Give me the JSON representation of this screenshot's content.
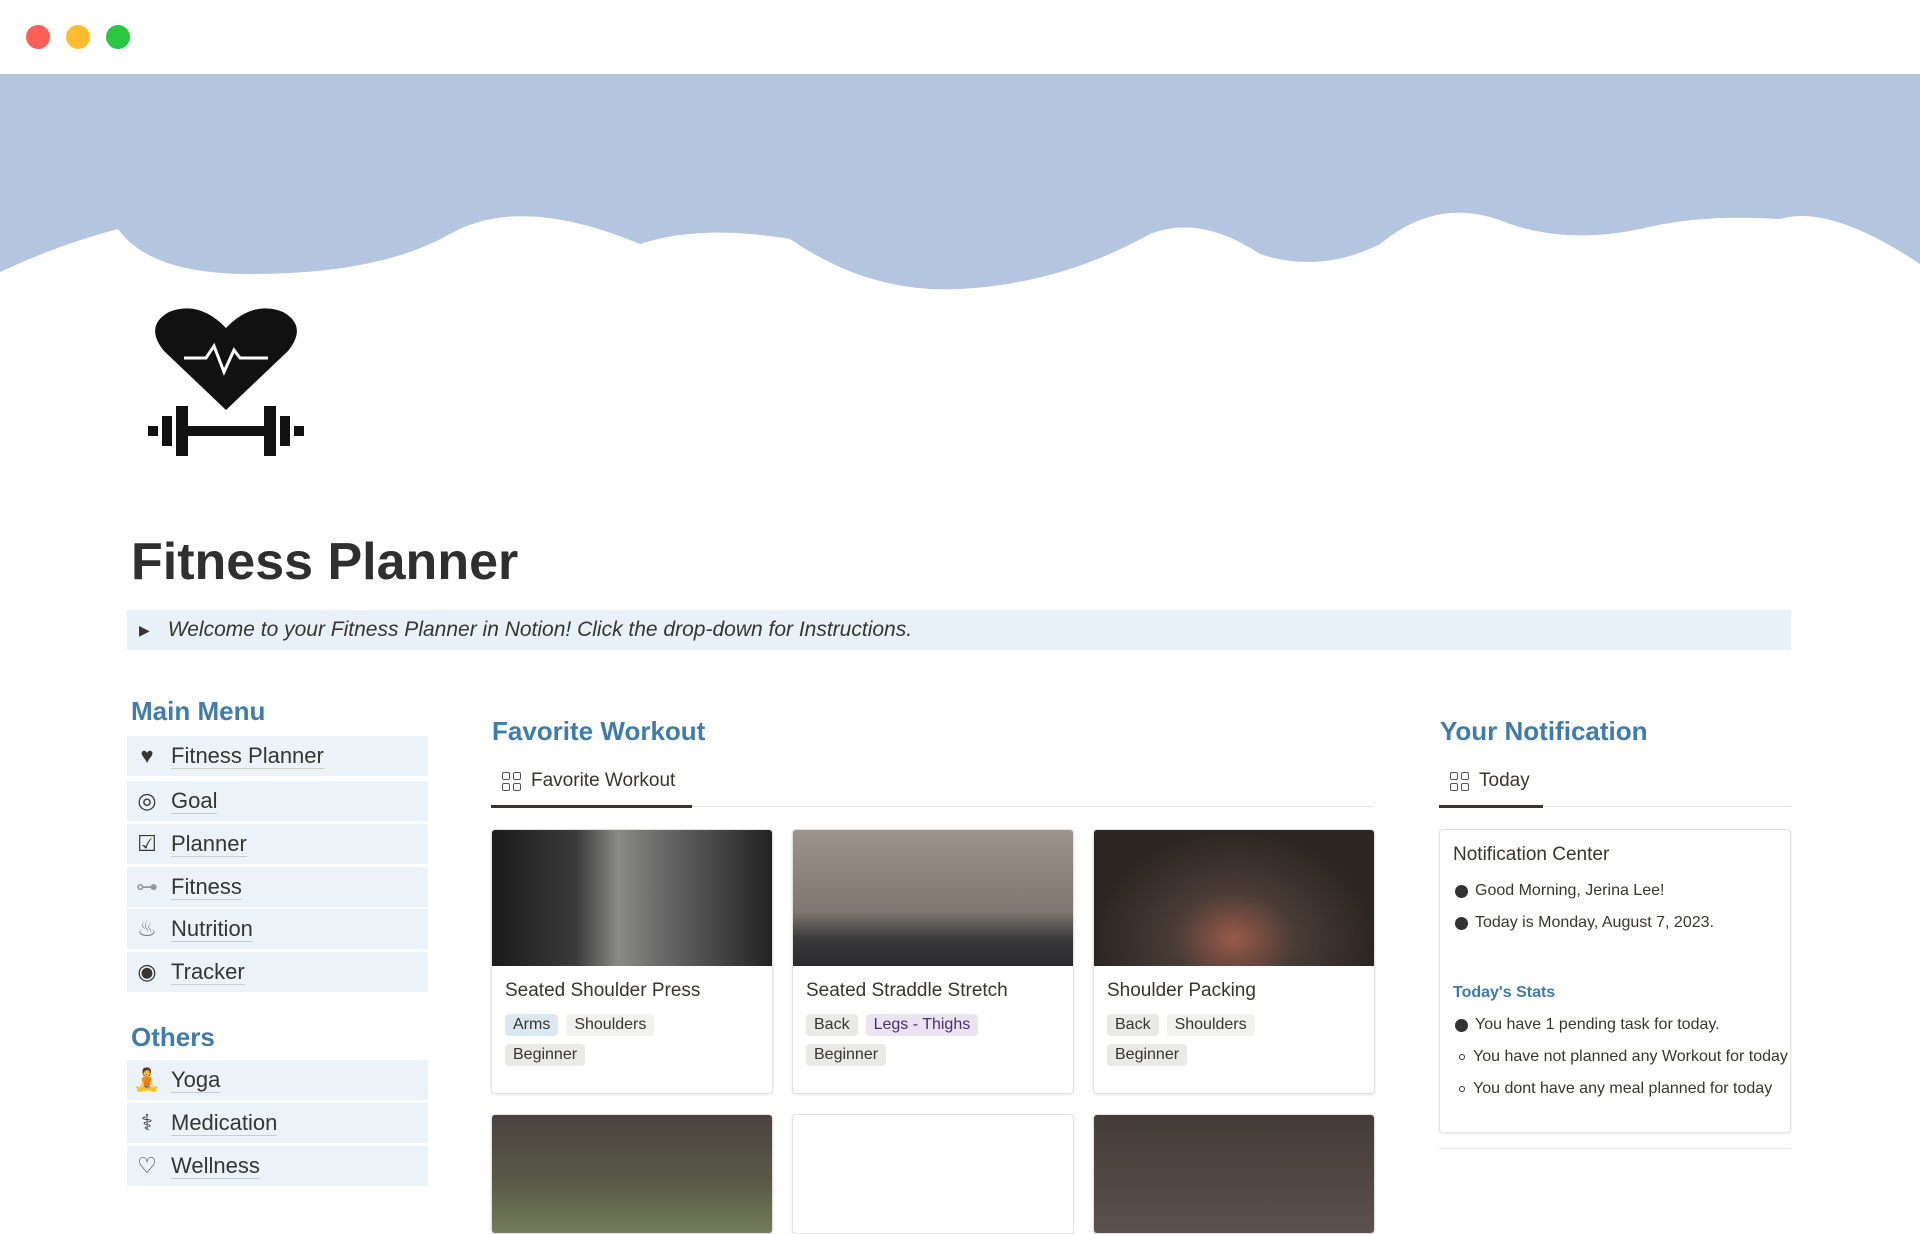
{
  "window": {
    "controls": [
      "close",
      "minimize",
      "zoom"
    ],
    "colors": {
      "close": "#fe5f57",
      "minimize": "#febc2e",
      "zoom": "#28c840"
    }
  },
  "page": {
    "title": "Fitness Planner",
    "icon": "heart-dumbbell-icon",
    "cover_color": "#b3c5df"
  },
  "callout": {
    "text": "Welcome to your Fitness Planner in Notion! Click the drop-down for Instructions."
  },
  "main_menu": {
    "heading": "Main Menu",
    "items": [
      {
        "label": "Fitness Planner",
        "icon": "heart-dumbbell-icon"
      },
      {
        "label": "Goal",
        "icon": "target-icon"
      },
      {
        "label": "Planner",
        "icon": "checklist-icon"
      },
      {
        "label": "Fitness",
        "icon": "dumbbell-icon"
      },
      {
        "label": "Nutrition",
        "icon": "food-icon"
      },
      {
        "label": "Tracker",
        "icon": "crosshair-icon"
      }
    ]
  },
  "others": {
    "heading": "Others",
    "items": [
      {
        "label": "Yoga",
        "icon": "yoga-icon"
      },
      {
        "label": "Medication",
        "icon": "stethoscope-icon"
      },
      {
        "label": "Wellness",
        "icon": "hand-heart-icon"
      }
    ]
  },
  "favorite": {
    "heading": "Favorite Workout",
    "tab": "Favorite Workout",
    "cards": [
      {
        "name": "Seated Shoulder Press",
        "tags": [
          "Arms",
          "Shoulders"
        ],
        "level": "Beginner"
      },
      {
        "name": "Seated Straddle Stretch",
        "tags": [
          "Back",
          "Legs - Thighs"
        ],
        "level": "Beginner"
      },
      {
        "name": "Shoulder Packing",
        "tags": [
          "Back",
          "Shoulders"
        ],
        "level": "Beginner"
      }
    ]
  },
  "notification": {
    "heading": "Your Notification",
    "tab": "Today",
    "card_title": "Notification Center",
    "lines": [
      "Good Morning, Jerina Lee!",
      "Today is Monday, August 7, 2023."
    ],
    "stats_heading": "Today's Stats",
    "stats": [
      "You have 1 pending task for today.",
      "You have not planned any Workout for today",
      "You dont have any meal planned for today"
    ]
  },
  "accent": "#3f7bab"
}
